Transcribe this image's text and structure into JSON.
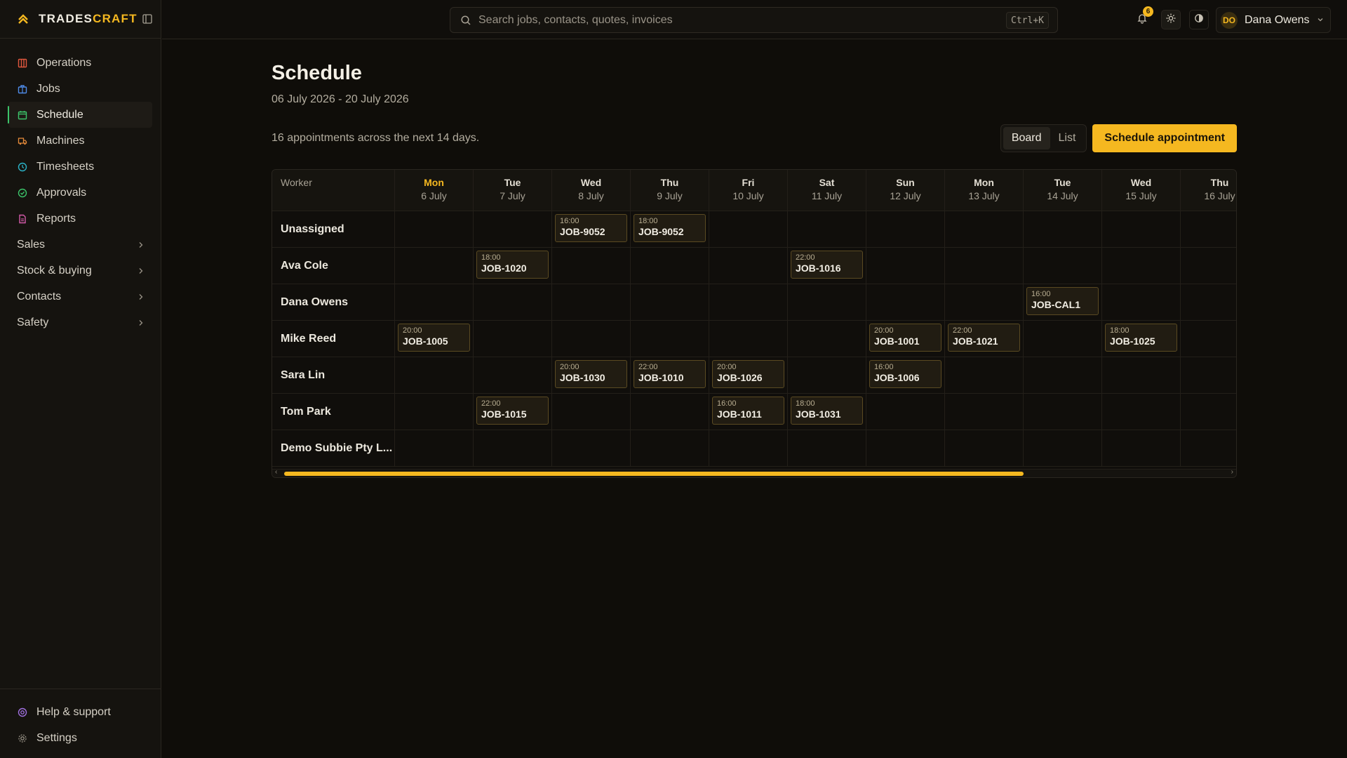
{
  "brand": {
    "name_a": "TRADES",
    "name_b": "CRAFT"
  },
  "sidebar": {
    "items": [
      {
        "label": "Operations",
        "icon": "operations-icon",
        "color": "#e0573e"
      },
      {
        "label": "Jobs",
        "icon": "briefcase-icon",
        "color": "#4f8be8"
      },
      {
        "label": "Schedule",
        "icon": "calendar-icon",
        "color": "#3cc46a",
        "active": true
      },
      {
        "label": "Machines",
        "icon": "truck-icon",
        "color": "#e58a3a"
      },
      {
        "label": "Timesheets",
        "icon": "clock-icon",
        "color": "#2bb3c8"
      },
      {
        "label": "Approvals",
        "icon": "check-circle-icon",
        "color": "#3cc46a"
      },
      {
        "label": "Reports",
        "icon": "document-icon",
        "color": "#d25aa8"
      }
    ],
    "groups": [
      {
        "label": "Sales"
      },
      {
        "label": "Stock & buying"
      },
      {
        "label": "Contacts"
      },
      {
        "label": "Safety"
      }
    ],
    "bottom": [
      {
        "label": "Help & support",
        "icon": "help-icon",
        "color": "#a070e0"
      },
      {
        "label": "Settings",
        "icon": "gear-icon",
        "color": "#9a9488"
      }
    ]
  },
  "topbar": {
    "search_placeholder": "Search jobs, contacts, quotes, invoices",
    "shortcut": "Ctrl+K",
    "notification_count": "6",
    "user_initials": "DO",
    "user_name": "Dana Owens"
  },
  "page": {
    "title": "Schedule",
    "date_range": "06 July 2026 - 20 July 2026",
    "summary": "16 appointments across the next 14 days.",
    "view_board": "Board",
    "view_list": "List",
    "primary_action": "Schedule appointment"
  },
  "board": {
    "worker_header": "Worker",
    "days": [
      {
        "name": "Mon",
        "date": "6 July",
        "today": true
      },
      {
        "name": "Tue",
        "date": "7 July"
      },
      {
        "name": "Wed",
        "date": "8 July"
      },
      {
        "name": "Thu",
        "date": "9 July"
      },
      {
        "name": "Fri",
        "date": "10 July"
      },
      {
        "name": "Sat",
        "date": "11 July"
      },
      {
        "name": "Sun",
        "date": "12 July"
      },
      {
        "name": "Mon",
        "date": "13 July"
      },
      {
        "name": "Tue",
        "date": "14 July"
      },
      {
        "name": "Wed",
        "date": "15 July"
      },
      {
        "name": "Thu",
        "date": "16 July"
      }
    ],
    "workers": [
      {
        "name": "Unassigned",
        "appointments": [
          {
            "day": 2,
            "time": "16:00",
            "job": "JOB-9052"
          },
          {
            "day": 3,
            "time": "18:00",
            "job": "JOB-9052"
          }
        ]
      },
      {
        "name": "Ava Cole",
        "appointments": [
          {
            "day": 1,
            "time": "18:00",
            "job": "JOB-1020"
          },
          {
            "day": 5,
            "time": "22:00",
            "job": "JOB-1016"
          }
        ]
      },
      {
        "name": "Dana Owens",
        "appointments": [
          {
            "day": 8,
            "time": "16:00",
            "job": "JOB-CAL1"
          }
        ]
      },
      {
        "name": "Mike Reed",
        "appointments": [
          {
            "day": 0,
            "time": "20:00",
            "job": "JOB-1005"
          },
          {
            "day": 6,
            "time": "20:00",
            "job": "JOB-1001"
          },
          {
            "day": 7,
            "time": "22:00",
            "job": "JOB-1021"
          },
          {
            "day": 9,
            "time": "18:00",
            "job": "JOB-1025"
          }
        ]
      },
      {
        "name": "Sara Lin",
        "appointments": [
          {
            "day": 2,
            "time": "20:00",
            "job": "JOB-1030"
          },
          {
            "day": 3,
            "time": "22:00",
            "job": "JOB-1010"
          },
          {
            "day": 4,
            "time": "20:00",
            "job": "JOB-1026"
          },
          {
            "day": 6,
            "time": "16:00",
            "job": "JOB-1006"
          }
        ]
      },
      {
        "name": "Tom Park",
        "appointments": [
          {
            "day": 1,
            "time": "22:00",
            "job": "JOB-1015"
          },
          {
            "day": 4,
            "time": "16:00",
            "job": "JOB-1011"
          },
          {
            "day": 5,
            "time": "18:00",
            "job": "JOB-1031"
          }
        ]
      },
      {
        "name": "Demo Subbie Pty L...",
        "appointments": []
      }
    ]
  },
  "colors": {
    "accent": "#f5b820",
    "active_indicator": "#3cc46a",
    "background": "#0f0d09"
  }
}
